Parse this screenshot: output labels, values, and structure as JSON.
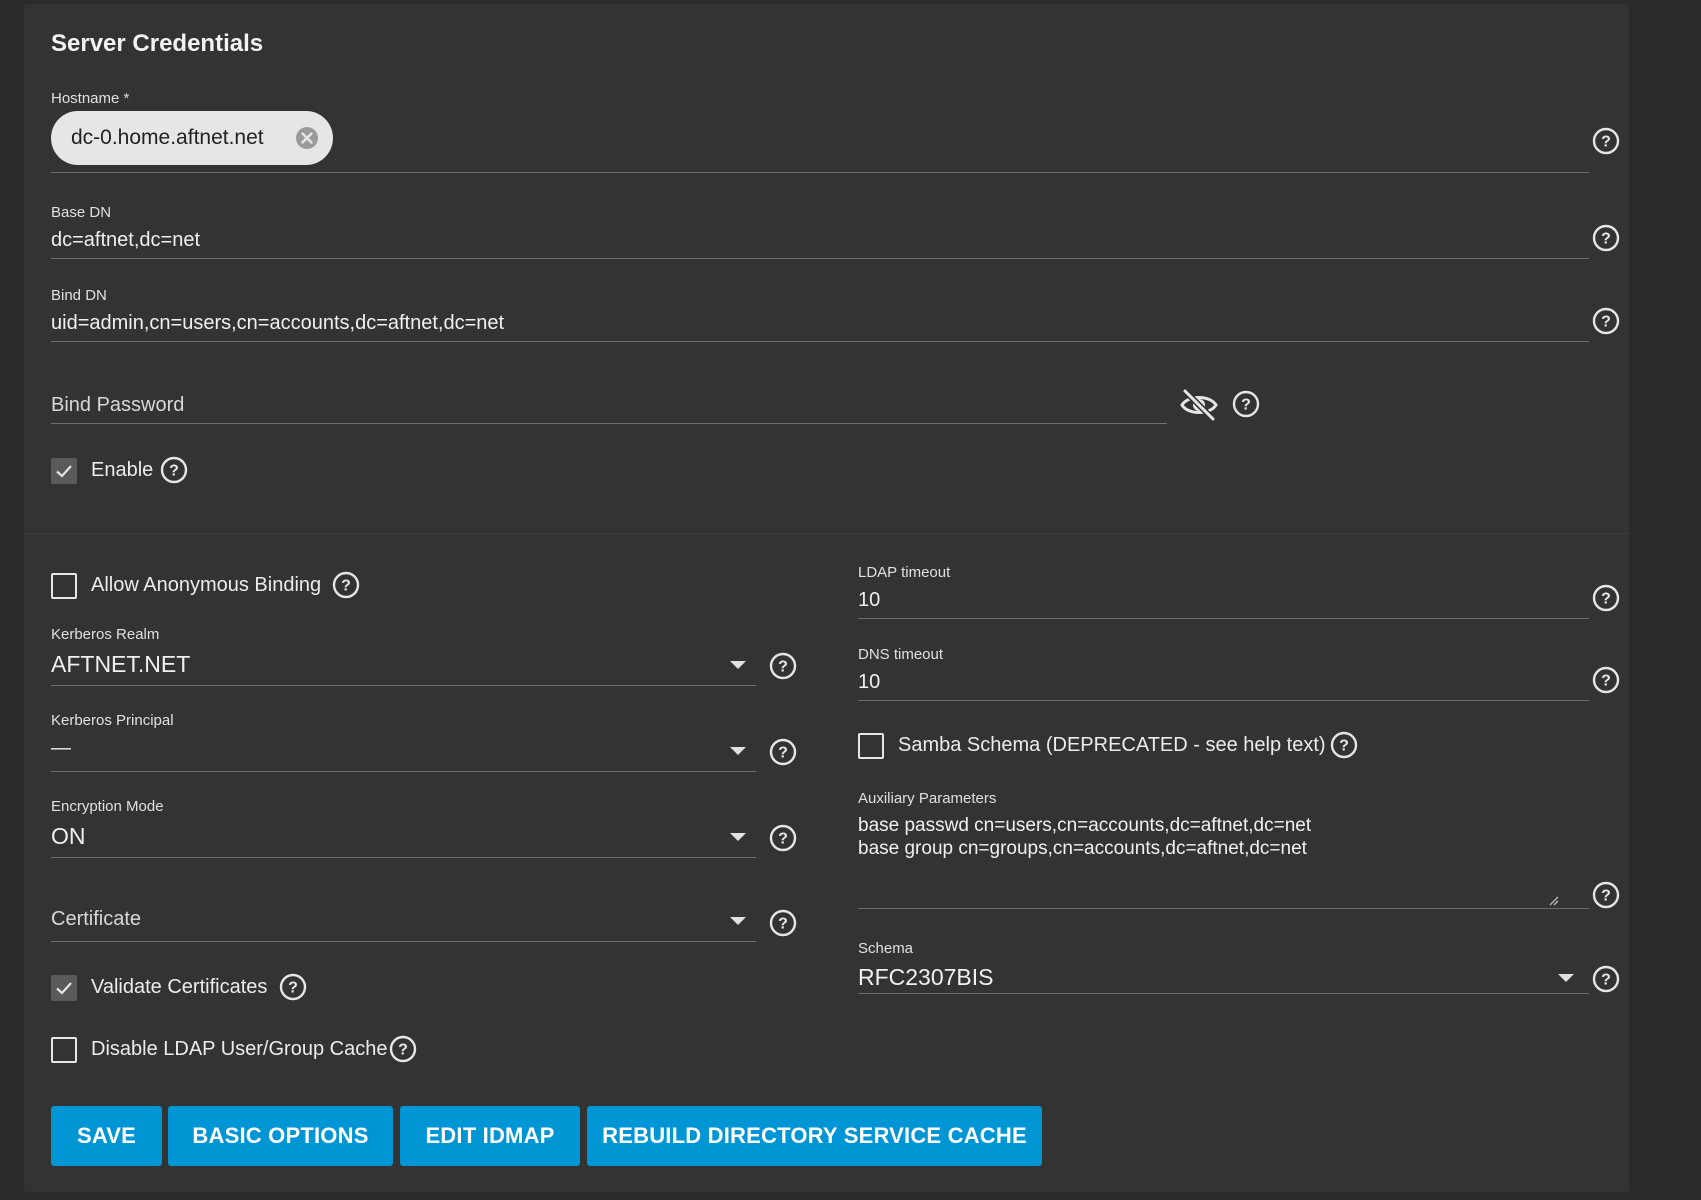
{
  "server_credentials": {
    "title": "Server Credentials",
    "hostname": {
      "label": "Hostname *",
      "chip": "dc-0.home.aftnet.net"
    },
    "base_dn": {
      "label": "Base DN",
      "value": "dc=aftnet,dc=net"
    },
    "bind_dn": {
      "label": "Bind DN",
      "value": "uid=admin,cn=users,cn=accounts,dc=aftnet,dc=net"
    },
    "bind_password": {
      "placeholder": "Bind Password"
    },
    "enable": {
      "label": "Enable",
      "checked": true
    }
  },
  "advanced": {
    "allow_anonymous_binding": {
      "label": "Allow Anonymous Binding",
      "checked": false
    },
    "kerberos_realm": {
      "label": "Kerberos Realm",
      "value": "AFTNET.NET"
    },
    "kerberos_principal": {
      "label": "Kerberos Principal",
      "value": "—"
    },
    "encryption_mode": {
      "label": "Encryption Mode",
      "value": "ON"
    },
    "certificate": {
      "placeholder": "Certificate"
    },
    "validate_certificates": {
      "label": "Validate Certificates",
      "checked": true
    },
    "disable_cache": {
      "label": "Disable LDAP User/Group Cache",
      "checked": false
    },
    "ldap_timeout": {
      "label": "LDAP timeout",
      "value": "10"
    },
    "dns_timeout": {
      "label": "DNS timeout",
      "value": "10"
    },
    "samba_schema": {
      "label": "Samba Schema (DEPRECATED - see help text)",
      "checked": false
    },
    "auxiliary_parameters": {
      "label": "Auxiliary Parameters",
      "value": "base passwd cn=users,cn=accounts,dc=aftnet,dc=net\nbase group cn=groups,cn=accounts,dc=aftnet,dc=net"
    },
    "schema": {
      "label": "Schema",
      "value": "RFC2307BIS"
    }
  },
  "buttons": {
    "save": "SAVE",
    "basic_options": "BASIC OPTIONS",
    "edit_idmap": "EDIT IDMAP",
    "rebuild_cache": "REBUILD DIRECTORY SERVICE CACHE"
  },
  "colors": {
    "background": "#2a2a2a",
    "card": "#333333",
    "primary_button": "#0095d5",
    "chip": "#e6e6e6"
  }
}
